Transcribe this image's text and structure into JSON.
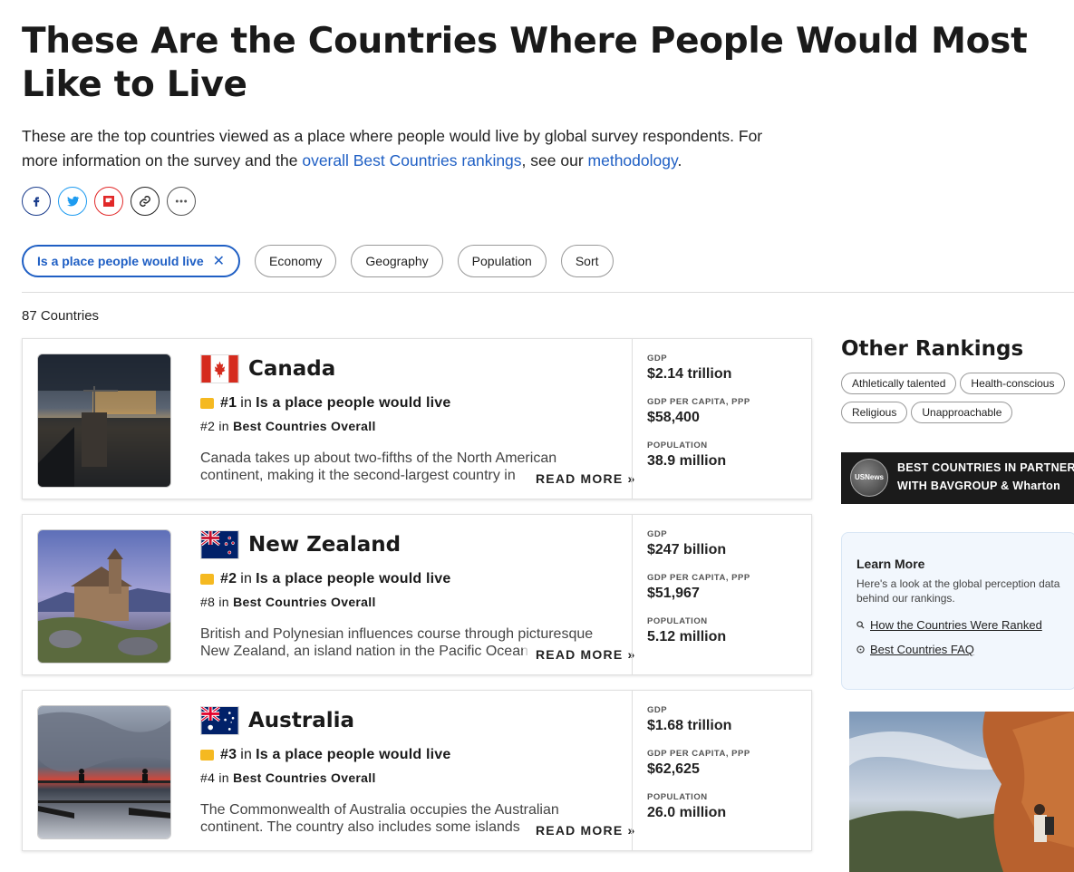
{
  "page": {
    "title": "These Are the Countries Where People Would Most Like to Live",
    "intro_text": "These are the top countries viewed as a place where people would live by global survey respondents. For more information on the survey and the ",
    "intro_link1": "overall Best Countries rankings",
    "intro_mid": ", see our ",
    "intro_link2": "methodology",
    "intro_end": "."
  },
  "share": {
    "icons": [
      "facebook-icon",
      "twitter-icon",
      "flipboard-icon",
      "link-icon",
      "more-icon"
    ]
  },
  "filters": {
    "active": "Is a place people would live",
    "options": [
      "Economy",
      "Geography",
      "Population",
      "Sort"
    ]
  },
  "results_count": "87 Countries",
  "countries": [
    {
      "name": "Canada",
      "rank": "#1",
      "in": "in",
      "category": "Is a place people would live",
      "overall_rank": "#2",
      "overall_label": "Best Countries Overall",
      "description": "Canada takes up about two-fifths of the North American continent, making it the second-largest country in",
      "read_more": "READ MORE »",
      "gdp_label": "GDP",
      "gdp": "$2.14 trillion",
      "gdp_pc_label": "GDP PER CAPITA, PPP",
      "gdp_pc": "$58,400",
      "pop_label": "POPULATION",
      "population": "38.9 million"
    },
    {
      "name": "New Zealand",
      "rank": "#2",
      "in": "in",
      "category": "Is a place people would live",
      "overall_rank": "#8",
      "overall_label": "Best Countries Overall",
      "description": "British and Polynesian influences course through picturesque New Zealand, an island nation in the Pacific Ocean",
      "read_more": "READ MORE »",
      "gdp_label": "GDP",
      "gdp": "$247 billion",
      "gdp_pc_label": "GDP PER CAPITA, PPP",
      "gdp_pc": "$51,967",
      "pop_label": "POPULATION",
      "population": "5.12 million"
    },
    {
      "name": "Australia",
      "rank": "#3",
      "in": "in",
      "category": "Is a place people would live",
      "overall_rank": "#4",
      "overall_label": "Best Countries Overall",
      "description": "The Commonwealth of Australia occupies the Australian continent. The country also includes some islands",
      "read_more": "READ MORE »",
      "gdp_label": "GDP",
      "gdp": "$1.68 trillion",
      "gdp_pc_label": "GDP PER CAPITA, PPP",
      "gdp_pc": "$62,625",
      "pop_label": "POPULATION",
      "population": "26.0 million"
    }
  ],
  "sidebar": {
    "title": "Other Rankings",
    "rankings": [
      "Athletically talented",
      "Health-conscious",
      "Religious",
      "Unapproachable"
    ],
    "banner": {
      "logo_text": "USNews",
      "line1": "BEST COUNTRIES IN PARTNERSHIP",
      "line2": "WITH BAVGROUP & Wharton"
    },
    "learn_more": {
      "title": "Learn More",
      "desc": "Here's a look at the global perception data behind our rankings.",
      "link1": "How the Countries Were Ranked",
      "link2": "Best Countries FAQ"
    }
  },
  "colors": {
    "link": "#1f5fc4",
    "rank_badge": "#f5b921",
    "card_border": "#e0e0e0"
  }
}
